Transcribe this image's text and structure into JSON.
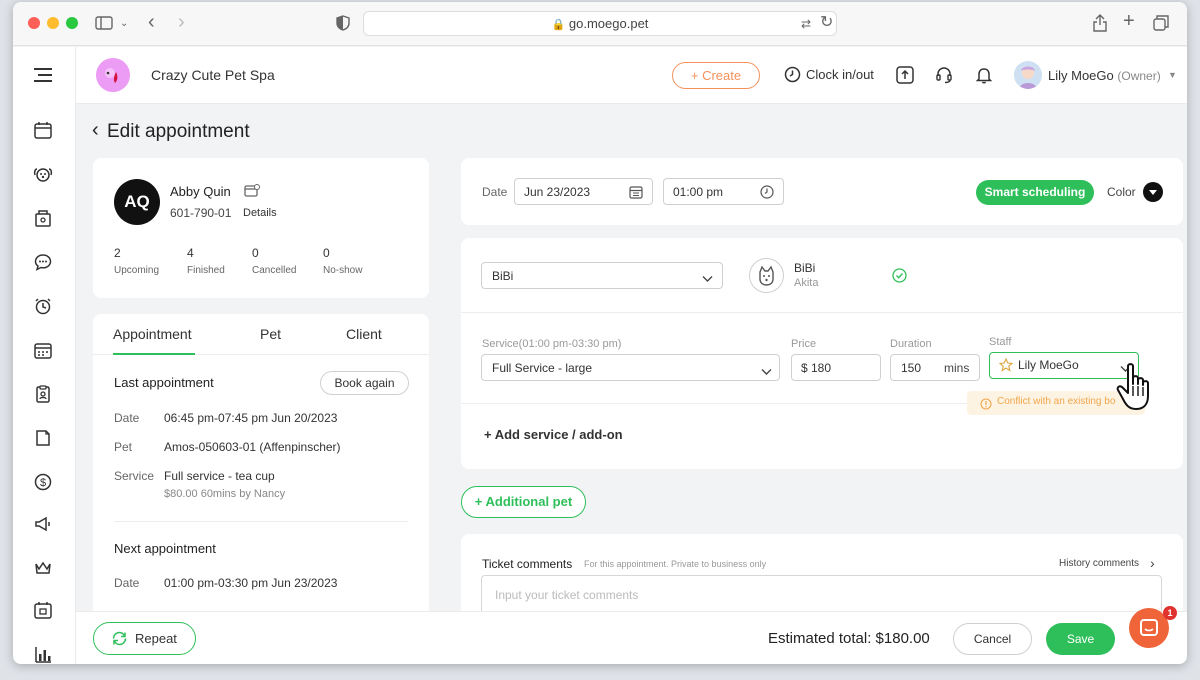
{
  "browser": {
    "url": "go.moego.pet"
  },
  "business": {
    "name": "Crazy Cute Pet Spa"
  },
  "topbar": {
    "create_label": "+ Create",
    "clock_label": "Clock in/out",
    "user_name": "Lily MoeGo",
    "user_role": "(Owner)"
  },
  "page": {
    "back_glyph": "‹",
    "title": "Edit appointment"
  },
  "client": {
    "initials": "AQ",
    "name": "Abby Quin",
    "phone": "601-790-01",
    "details_link": "Details",
    "stats": [
      {
        "value": "2",
        "label": "Upcoming"
      },
      {
        "value": "4",
        "label": "Finished"
      },
      {
        "value": "0",
        "label": "Cancelled"
      },
      {
        "value": "0",
        "label": "No-show"
      }
    ]
  },
  "info_tabs": [
    "Appointment",
    "Pet",
    "Client"
  ],
  "last_appt": {
    "heading": "Last appointment",
    "book_again": "Book again",
    "date_label": "Date",
    "date_value": "06:45 pm-07:45 pm Jun 20/2023",
    "pet_label": "Pet",
    "pet_value": "Amos-050603-01 (Affenpinscher)",
    "service_label": "Service",
    "service_value": "Full service - tea cup",
    "service_detail": "$80.00  60mins by Nancy"
  },
  "next_appt": {
    "heading": "Next appointment",
    "date_label": "Date",
    "date_value": "01:00 pm-03:30 pm Jun 23/2023"
  },
  "datetime": {
    "date_label": "Date",
    "date_value": "Jun 23/2023",
    "time_value": "01:00 pm",
    "smart_label": "Smart scheduling",
    "color_label": "Color"
  },
  "pet": {
    "select_value": "BiBi",
    "name": "BiBi",
    "breed": "Akita"
  },
  "service": {
    "label": "Service(01:00 pm-03:30 pm)",
    "value": "Full Service - large",
    "price_label": "Price",
    "price_value": "$ 180",
    "duration_label": "Duration",
    "duration_value": "150",
    "duration_unit": "mins",
    "staff_label": "Staff",
    "staff_value": "Lily MoeGo",
    "conflict_text": "Conflict with an existing bo"
  },
  "add_service": "+ Add service / add-on",
  "additional_pet": "+ Additional pet",
  "comments": {
    "title": "Ticket comments",
    "hint": "For this appointment. Private to business only",
    "history": "History comments",
    "placeholder": "Input your ticket comments"
  },
  "footer": {
    "repeat": "Repeat",
    "estimated_total": "Estimated total: $180.00",
    "cancel": "Cancel",
    "save": "Save",
    "chat_badge": "1"
  },
  "colors": {
    "brand_green": "#2fbf5a",
    "brand_orange": "#f5915c",
    "chat_orange": "#f0643a"
  }
}
